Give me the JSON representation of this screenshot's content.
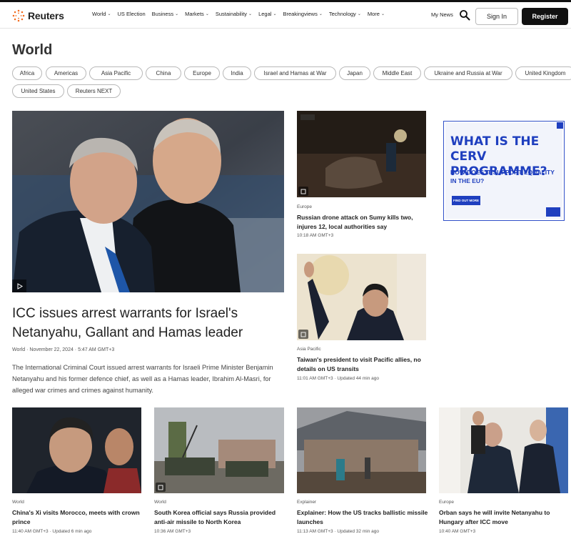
{
  "header": {
    "logo_text": "Reuters",
    "nav": [
      {
        "label": "World",
        "chevron": true
      },
      {
        "label": "US Election",
        "chevron": false
      },
      {
        "label": "Business",
        "chevron": true
      },
      {
        "label": "Markets",
        "chevron": true
      },
      {
        "label": "Sustainability",
        "chevron": true
      },
      {
        "label": "Legal",
        "chevron": true
      },
      {
        "label": "Breakingviews",
        "chevron": true
      },
      {
        "label": "Technology",
        "chevron": true
      },
      {
        "label": "More",
        "chevron": true
      }
    ],
    "my_news": "My News",
    "sign_in": "Sign In",
    "register": "Register"
  },
  "page_title": "World",
  "chips": [
    "Africa",
    "Americas",
    "Asia Pacific",
    "China",
    "Europe",
    "India",
    "Israel and Hamas at War",
    "Japan",
    "Middle East",
    "Ukraine and Russia at War",
    "United Kingdom",
    "United States",
    "Reuters NEXT"
  ],
  "hero": {
    "headline": "ICC issues arrest warrants for Israel's Netanyahu, Gallant and Hamas leader",
    "meta": "World · November 22, 2024 · 5:47 AM GMT+3",
    "summary": "The International Criminal Court issued arrest warrants for Israeli Prime Minister Benjamin Netanyahu and his former defence chief, as well as a Hamas leader, Ibrahim Al-Masri, for alleged war crimes and crimes against humanity."
  },
  "side_stories": [
    {
      "tag": "Europe",
      "title": "Russian drone attack on Sumy kills two, injures 12, local authorities say",
      "meta": "10:18 AM GMT+3"
    },
    {
      "tag": "Asia Pacific",
      "title": "Taiwan's president to visit Pacific allies, no details on US transits",
      "meta": "11:01 AM GMT+3 · Updated 44 min ago"
    }
  ],
  "ad": {
    "headline": "WHAT IS THE CERV PROGRAMME?",
    "subhead": "HOW DOES IT SUPPORT EQUALITY IN THE EU?",
    "button": "FIND OUT MORE"
  },
  "bottom_stories": [
    {
      "tag": "World",
      "title": "China's Xi visits Morocco, meets with crown prince",
      "meta": "11:40 AM GMT+3 · Updated 6 min ago"
    },
    {
      "tag": "World",
      "title": "South Korea official says Russia provided anti-air missile to North Korea",
      "meta": "10:36 AM GMT+3"
    },
    {
      "tag": "Explainer",
      "title": "Explainer: How the US tracks ballistic missile launches",
      "meta": "11:13 AM GMT+3 · Updated 32 min ago"
    },
    {
      "tag": "Europe",
      "title": "Orban says he will invite Netanyahu to Hungary after ICC move",
      "meta": "10:40 AM GMT+3"
    }
  ]
}
